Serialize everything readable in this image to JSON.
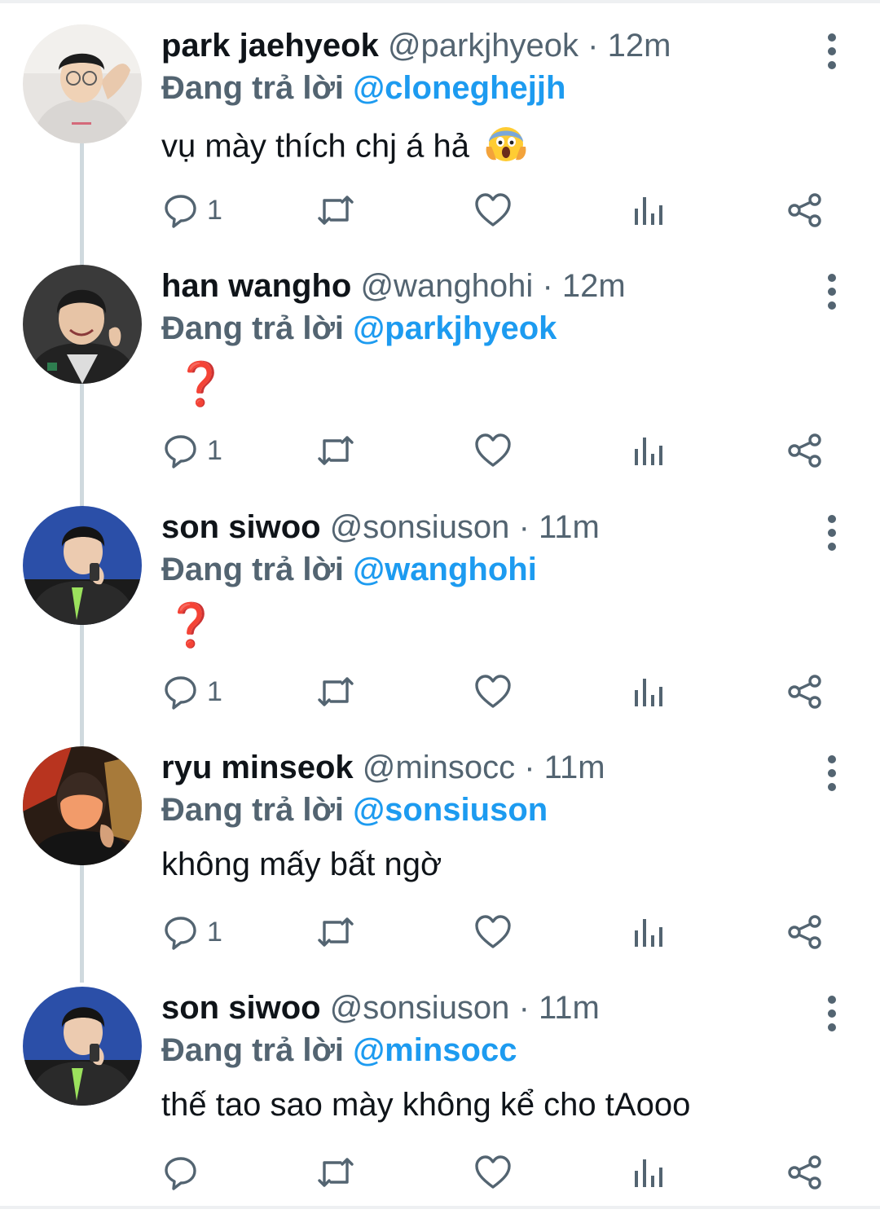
{
  "colors": {
    "text": "#0f1419",
    "muted": "#536471",
    "link": "#1d9bf0",
    "thread_line": "#cfd9de",
    "question_mark": "#e0243a"
  },
  "icons": {
    "reply": "reply-icon",
    "retweet": "retweet-icon",
    "like": "heart-icon",
    "views": "views-chart-icon",
    "share": "share-icon",
    "more": "more-vertical-icon"
  },
  "tweets": [
    {
      "name": "park jaehyeok",
      "handle": "@parkjhyeok",
      "separator": "·",
      "time": "12m",
      "reply_prefix": "Đang trả lời",
      "reply_to": "@cloneghejjh",
      "text": "vụ mày thích chj á hả",
      "emoji": "face-screaming-in-fear",
      "reply_count": "1"
    },
    {
      "name": "han wangho",
      "handle": "@wanghohi",
      "separator": "·",
      "time": "12m",
      "reply_prefix": "Đang trả lời",
      "reply_to": "@parkjhyeok",
      "text": "❓",
      "reply_count": "1"
    },
    {
      "name": "son siwoo",
      "handle": "@sonsiuson",
      "separator": "·",
      "time": "11m",
      "reply_prefix": "Đang trả lời",
      "reply_to": "@wanghohi",
      "text": "❓",
      "reply_count": "1"
    },
    {
      "name": "ryu minseok",
      "handle": "@minsocc",
      "separator": "·",
      "time": "11m",
      "reply_prefix": "Đang trả lời",
      "reply_to": "@sonsiuson",
      "text": "không mấy bất ngờ",
      "reply_count": "1"
    },
    {
      "name": "son siwoo",
      "handle": "@sonsiuson",
      "separator": "·",
      "time": "11m",
      "reply_prefix": "Đang trả lời",
      "reply_to": "@minsocc",
      "text": "thế tao sao mày không kể cho tAooo",
      "reply_count": ""
    }
  ]
}
